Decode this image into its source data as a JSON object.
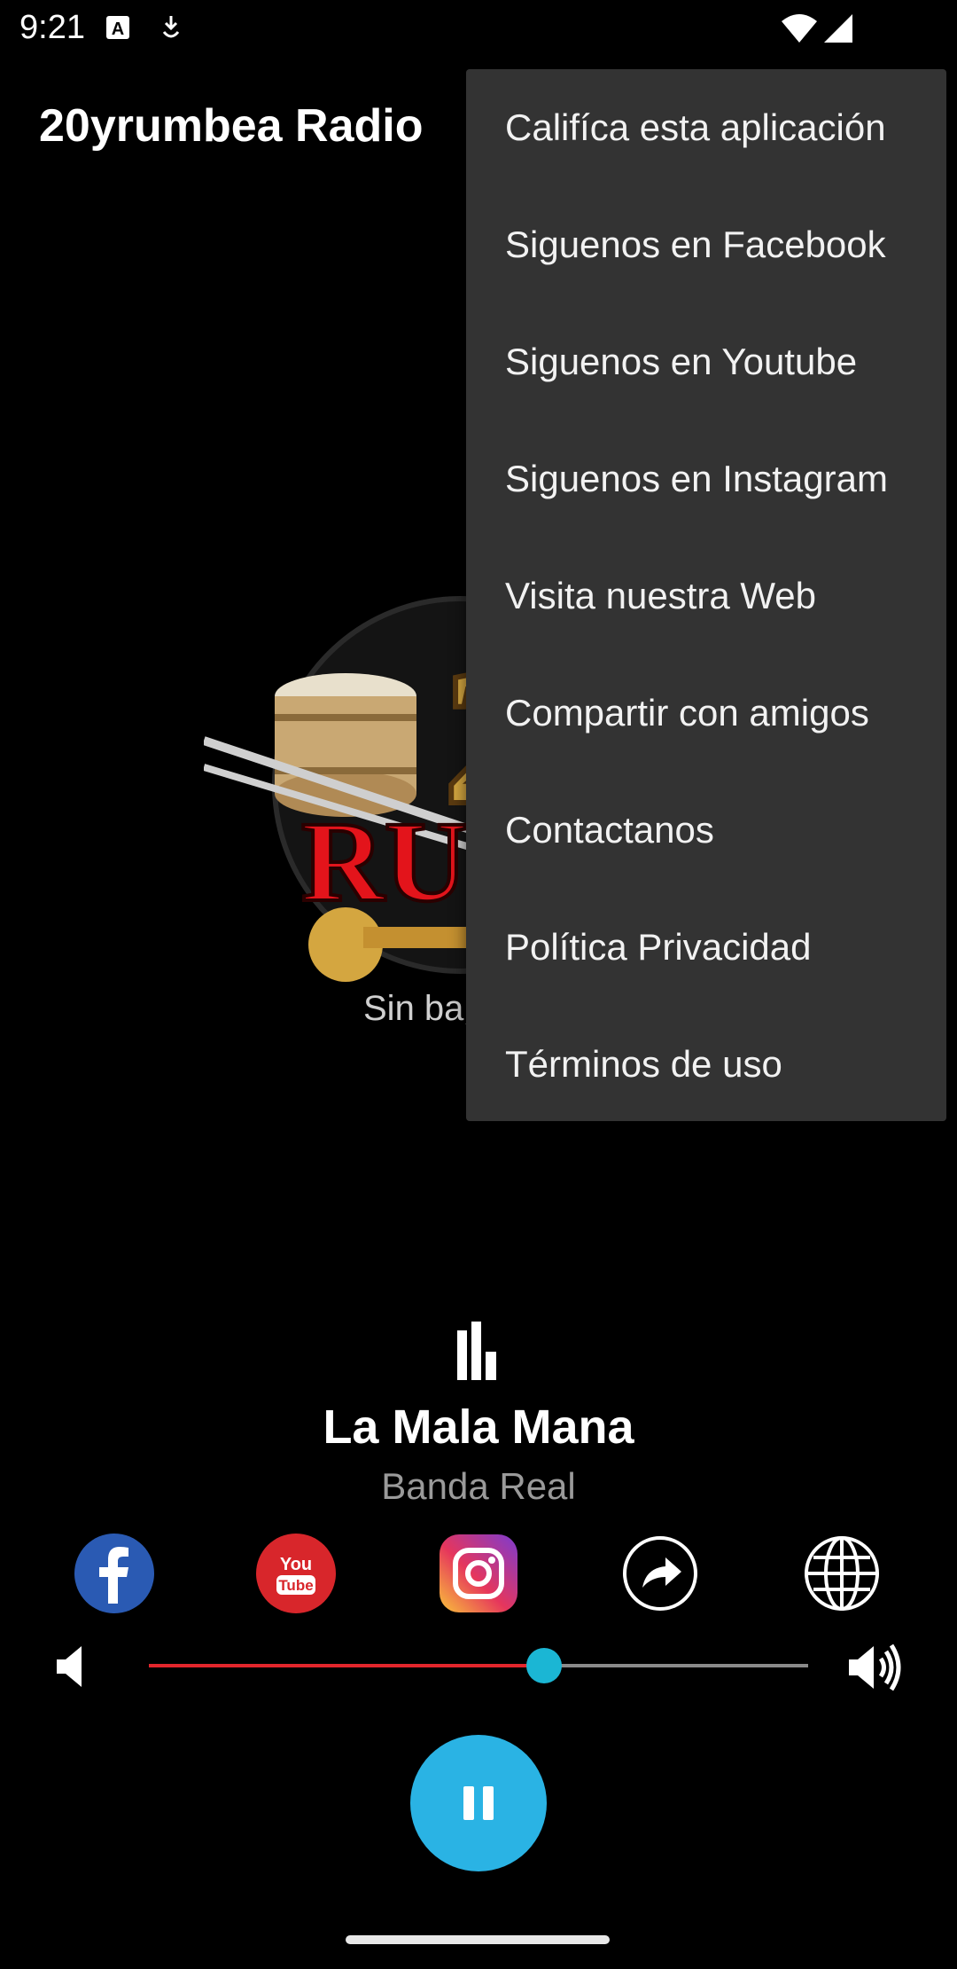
{
  "status_bar": {
    "time": "9:21",
    "icons": [
      "text-a-icon",
      "download-notification-icon",
      "wifi-icon",
      "cellular-signal-icon"
    ]
  },
  "app_bar": {
    "title": "20yrumbea Radio"
  },
  "artwork": {
    "logo_lines": [
      "2",
      "RUM",
      "Sin bajar"
    ],
    "colors": {
      "red": "#e3141b",
      "gold": "#d4a640"
    }
  },
  "menu": {
    "items": [
      "Califíca esta aplicación",
      "Siguenos en Facebook",
      "Siguenos en Youtube",
      "Siguenos en Instagram",
      "Visita nuestra Web",
      "Compartir con amigos",
      "Contactanos",
      "Política Privacidad",
      "Términos de uso"
    ],
    "background": "#333333"
  },
  "now_playing": {
    "song": "La Mala Mana",
    "artist": "Banda Real"
  },
  "social_buttons": [
    "facebook-icon",
    "youtube-icon",
    "instagram-icon",
    "share-icon",
    "globe-icon"
  ],
  "volume": {
    "level": 0.6,
    "fill_color": "#e3262c",
    "thumb_color": "#1bb6d4"
  },
  "player": {
    "state_icon": "pause-icon",
    "button_color": "#2ab3e4"
  }
}
